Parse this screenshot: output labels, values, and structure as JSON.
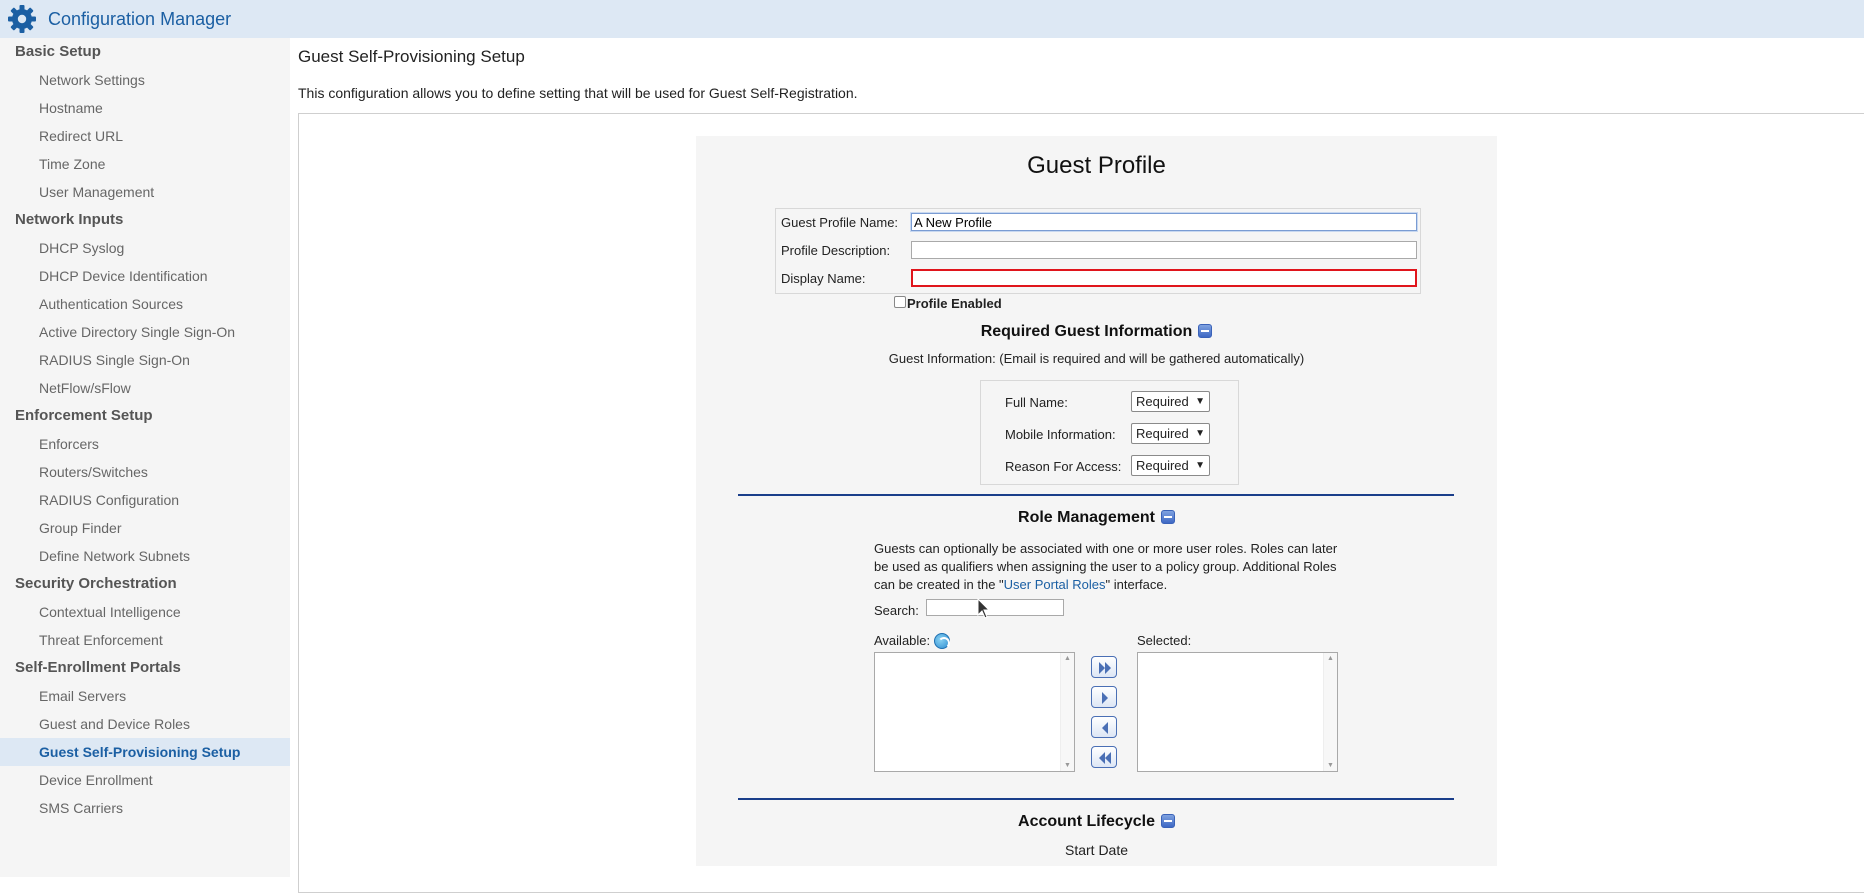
{
  "header": {
    "title": "Configuration Manager",
    "icon": "gear-icon",
    "accent": "#1b5fa3"
  },
  "sidebar": {
    "sections": [
      {
        "label": "Basic Setup",
        "items": [
          "Network Settings",
          "Hostname",
          "Redirect URL",
          "Time Zone",
          "User Management"
        ]
      },
      {
        "label": "Network Inputs",
        "items": [
          "DHCP Syslog",
          "DHCP Device Identification",
          "Authentication Sources",
          "Active Directory Single Sign-On",
          "RADIUS Single Sign-On",
          "NetFlow/sFlow"
        ]
      },
      {
        "label": "Enforcement Setup",
        "items": [
          "Enforcers",
          "Routers/Switches",
          "RADIUS Configuration",
          "Group Finder",
          "Define Network Subnets"
        ]
      },
      {
        "label": "Security Orchestration",
        "items": [
          "Contextual Intelligence",
          "Threat Enforcement"
        ]
      },
      {
        "label": "Self-Enrollment Portals",
        "items": [
          "Email Servers",
          "Guest and Device Roles",
          "Guest Self-Provisioning Setup",
          "Device Enrollment",
          "SMS Carriers"
        ]
      }
    ],
    "active_item": "Guest Self-Provisioning Setup"
  },
  "main": {
    "page_title": "Guest Self-Provisioning Setup",
    "intro": "This configuration allows you to define setting that will be used for Guest Self-Registration."
  },
  "profile": {
    "heading": "Guest Profile",
    "name_label": "Guest Profile Name:",
    "name_value": "A New Profile",
    "description_label": "Profile Description:",
    "description_value": "",
    "display_label": "Display Name:",
    "display_value": "",
    "enabled_label": "Profile Enabled",
    "enabled": false
  },
  "guest_info": {
    "heading": "Required Guest Information",
    "note": "Guest Information: (Email is required and will be gathered automatically)",
    "fields": [
      {
        "label": "Full Name:",
        "value": "Required"
      },
      {
        "label": "Mobile Information:",
        "value": "Required"
      },
      {
        "label": "Reason For Access:",
        "value": "Required"
      }
    ]
  },
  "roles": {
    "heading": "Role Management",
    "text_before": "Guests can optionally be associated with one or more user roles. Roles can later be used as qualifiers when assigning the user to a policy group. Additional Roles can be created in the \"",
    "link": "User Portal Roles",
    "text_after": "\" interface.",
    "search_label": "Search:",
    "search_value": "",
    "available_label": "Available:",
    "selected_label": "Selected:"
  },
  "lifecycle": {
    "heading": "Account Lifecycle",
    "start_date_label": "Start Date"
  }
}
